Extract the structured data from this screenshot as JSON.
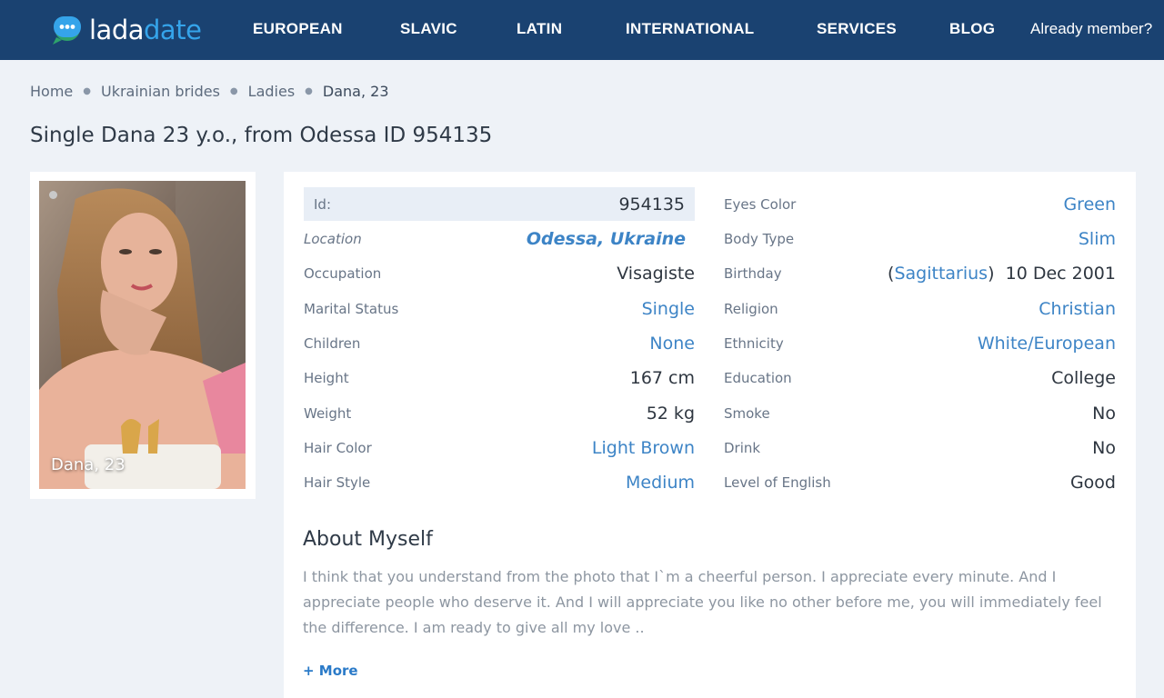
{
  "header": {
    "logo_part1": "lada",
    "logo_part2": "date",
    "nav": [
      "EUROPEAN",
      "SLAVIC",
      "LATIN",
      "INTERNATIONAL",
      "SERVICES",
      "BLOG"
    ],
    "member_link": "Already member?"
  },
  "breadcrumb": [
    "Home",
    "Ukrainian brides",
    "Ladies",
    "Dana, 23"
  ],
  "page_title": "Single Dana 23 y.o., from Odessa ID 954135",
  "photo": {
    "caption": "Dana, 23"
  },
  "profile": {
    "left": [
      {
        "label": "Id:",
        "value": "954135"
      },
      {
        "label": "Location",
        "value": "Odessa, Ukraine"
      },
      {
        "label": "Occupation",
        "value": "Visagiste"
      },
      {
        "label": "Marital Status",
        "value": "Single"
      },
      {
        "label": "Children",
        "value": "None"
      },
      {
        "label": "Height",
        "value": "167 cm"
      },
      {
        "label": "Weight",
        "value": "52 kg"
      },
      {
        "label": "Hair Color",
        "value": "Light Brown"
      },
      {
        "label": "Hair Style",
        "value": "Medium"
      }
    ],
    "right": [
      {
        "label": "Eyes Color",
        "value": "Green"
      },
      {
        "label": "Body Type",
        "value": "Slim"
      },
      {
        "label": "Birthday",
        "zodiac_open": "(",
        "zodiac": "Sagittarius",
        "zodiac_close": ")",
        "value": "10 Dec 2001"
      },
      {
        "label": "Religion",
        "value": "Christian"
      },
      {
        "label": "Ethnicity",
        "value": "White/European"
      },
      {
        "label": "Education",
        "value": "College"
      },
      {
        "label": "Smoke",
        "value": "No"
      },
      {
        "label": "Drink",
        "value": "No"
      },
      {
        "label": "Level of English",
        "value": "Good"
      }
    ]
  },
  "about": {
    "title": "About Myself",
    "text": "I think that you understand from the photo that I`m a cheerful person. I appreciate every minute. And I appreciate people who deserve it. And I will appreciate you like no other before me, you will immediately feel the difference. I am ready to give all my love ..",
    "more": "+ More"
  },
  "colors": {
    "header_bg": "#1a4271",
    "logo_accent": "#35a4ea",
    "link": "#3d84c6",
    "page_bg": "#eef2f7"
  }
}
